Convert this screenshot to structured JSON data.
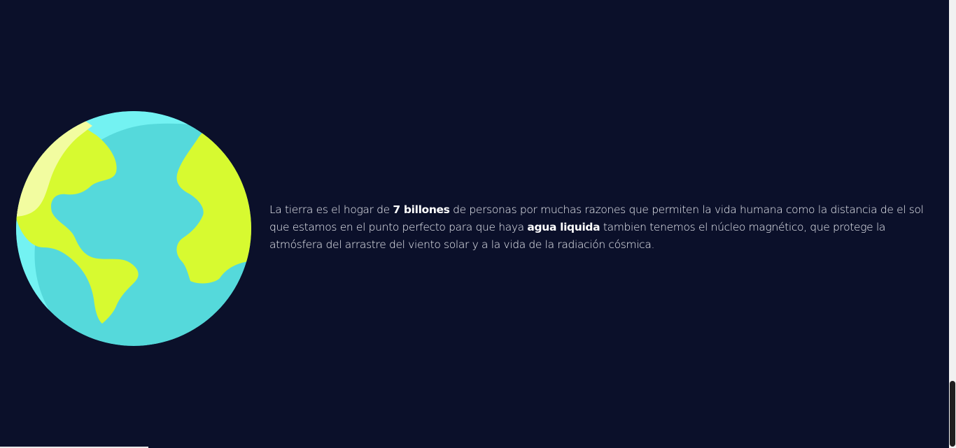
{
  "content": {
    "text_1": "La tierra es el hogar de ",
    "bold_1": "7 billones",
    "text_2": " de personas por muchas razones que permiten la vida humana como la distancia de el sol que estamos en el punto perfecto para que haya ",
    "bold_2": "agua liquida",
    "text_3": " tambien tenemos el núcleo magnético, que protege la atmósfera del arrastre del viento solar y a la vida de la radiación cósmica."
  },
  "colors": {
    "background": "#0b102a",
    "ocean": "#55d9db",
    "ocean_highlight": "#73f2f2",
    "land": "#d7fa30",
    "land_highlight": "#f2fca0",
    "text": "#eef0f6"
  },
  "icons": {
    "earth": "earth-globe-icon"
  }
}
